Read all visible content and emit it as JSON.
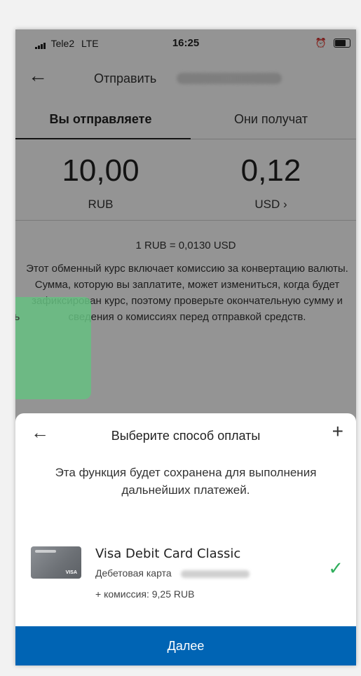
{
  "status_bar": {
    "carrier": "Tele2",
    "network": "LTE",
    "time": "16:25"
  },
  "header": {
    "back_icon": "arrow-left-icon",
    "title": "Отправить"
  },
  "tabs": [
    {
      "label": "Вы отправляете",
      "active": true
    },
    {
      "label": "Они получат",
      "active": false
    }
  ],
  "amounts": {
    "send": {
      "value": "10,00",
      "currency": "RUB"
    },
    "receive": {
      "value": "0,12",
      "currency": "USD",
      "chevron": "›"
    }
  },
  "rate": "1 RUB = 0,0130 USD",
  "rate_note": "Этот обменный курс включает комиссию за конвертацию валюты. Сумма, которую вы заплатите, может измениться, когда будет зафиксирован курс, поэтому проверьте окончательную сумму и сведения о комиссиях перед отправкой средств.",
  "sheet": {
    "title": "Выберите способ оплаты",
    "info": "Эта функция будет сохранена для выполнения дальнейших платежей.",
    "add_icon": "plus-icon",
    "method": {
      "name": "Visa Debit Card Classic",
      "type": "Дебетовая карта",
      "fee": "+ комиссия: 9,25 RUB",
      "card_mark": "VISA",
      "selected": true
    },
    "next_button": "Далее"
  },
  "colors": {
    "primary_button": "#0064b4",
    "check": "#2fae5c",
    "highlight": "#66bf81"
  }
}
